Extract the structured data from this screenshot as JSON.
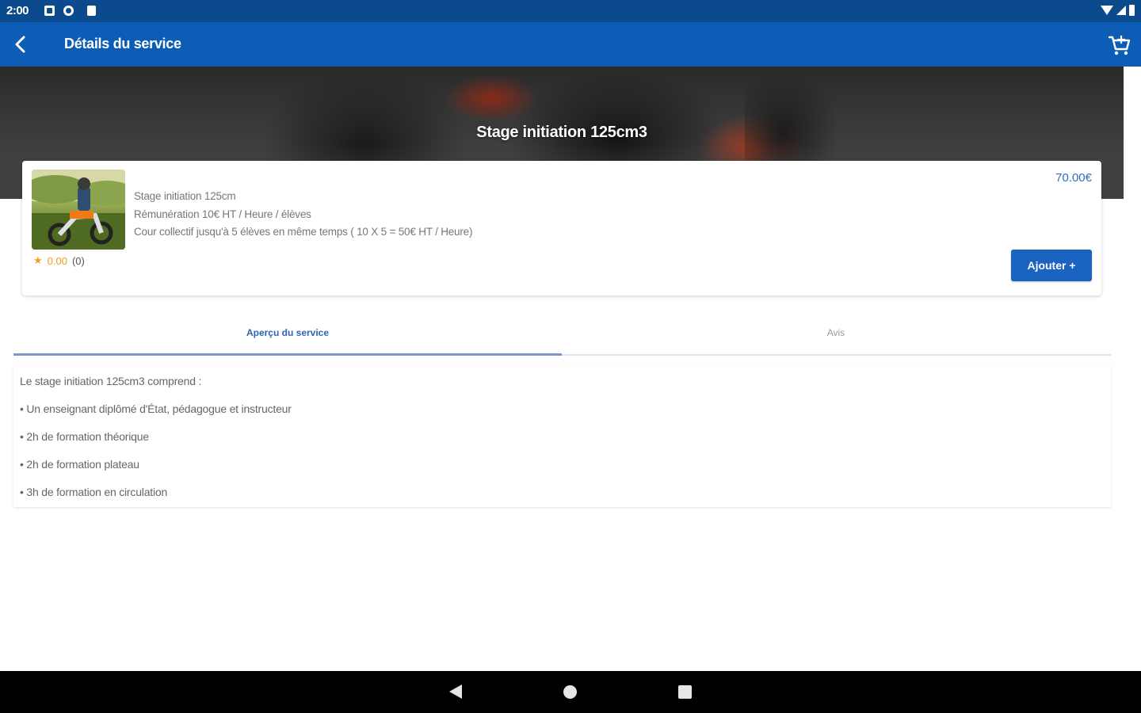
{
  "status_bar": {
    "time": "2:00",
    "icons": [
      "notification-icon",
      "p-icon",
      "sd-card-icon"
    ],
    "right_icons": [
      "wifi-icon",
      "signal-icon",
      "battery-icon"
    ]
  },
  "app_bar": {
    "title": "Détails du service",
    "back_icon": "arrow-back-icon",
    "cart_icon": "cart-icon",
    "background": "#0d5cb6"
  },
  "hero": {
    "title": "Stage initiation 125cm3"
  },
  "service": {
    "price": "70.00€",
    "description": [
      "Stage initiation 125cm",
      "Rémunération 10€ HT / Heure / élèves",
      "Cour collectif jusqu'à 5 élèves en même temps ( 10 X 5 = 50€ HT / Heure)"
    ],
    "rating_score": "0.00",
    "rating_count": "(0)",
    "add_button": "Ajouter +",
    "accent": "#1a63c1"
  },
  "tabs": [
    {
      "label": "Aperçu du service",
      "active": true
    },
    {
      "label": "Avis",
      "active": false
    }
  ],
  "overview": {
    "lines": [
      "Le stage initiation 125cm3 comprend :",
      "• Un enseignant diplômé d'État, pédagogue et instructeur",
      "• 2h de formation théorique",
      "• 2h de formation plateau",
      "• 3h de formation en circulation"
    ]
  },
  "nav_bar": {
    "icons": [
      "nav-back-icon",
      "nav-home-icon",
      "nav-recents-icon"
    ]
  }
}
